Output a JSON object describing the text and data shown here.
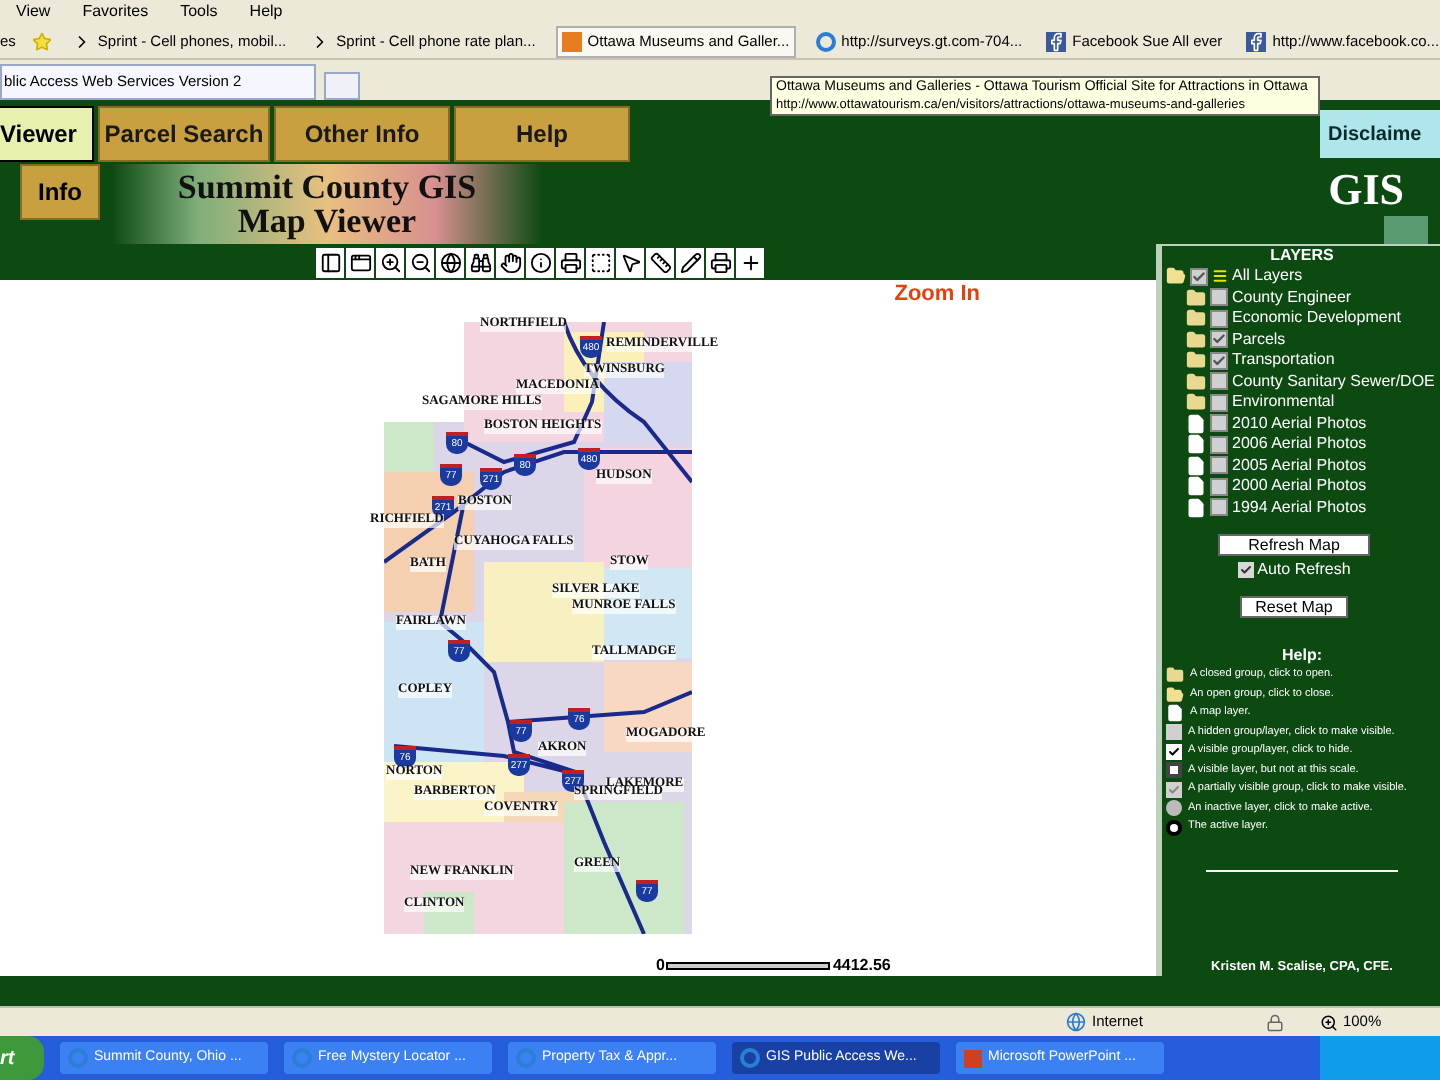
{
  "browser": {
    "menu": [
      "View",
      "Favorites",
      "Tools",
      "Help"
    ],
    "favorites": [
      {
        "label": "es",
        "kind": "text"
      },
      {
        "label": "Sprint - Cell phones, mobil...",
        "kind": "page"
      },
      {
        "label": "Sprint - Cell phone rate plan...",
        "kind": "page"
      },
      {
        "label": "Ottawa Museums and Galler...",
        "kind": "hover"
      },
      {
        "label": "http://surveys.gt.com-704...",
        "kind": "ie"
      },
      {
        "label": "Facebook Sue All ever",
        "kind": "facebook"
      },
      {
        "label": "http://www.facebook.co...",
        "kind": "facebook"
      }
    ],
    "tab": "blic Access Web Services Version 2",
    "tooltip": {
      "title": "Ottawa Museums and Galleries - Ottawa Tourism Official Site for Attractions in Ottawa",
      "url": "http://www.ottawatourism.ca/en/visitors/attractions/ottawa-museums-and-galleries"
    }
  },
  "nav": {
    "tabs": [
      {
        "label": "Viewer",
        "selected": true
      },
      {
        "label": "Parcel Search",
        "selected": false
      },
      {
        "label": "Other Info",
        "selected": false
      },
      {
        "label": "Help",
        "selected": false
      }
    ],
    "subtab": {
      "label": "Info",
      "selected": false
    },
    "disclaimer": "Disclaime"
  },
  "banner": {
    "title": "Summit County GIS",
    "subtitle": "Map Viewer"
  },
  "logo": "GIS",
  "map": {
    "mode": "Zoom In",
    "places": [
      "NORTHFIELD",
      "REMINDERVILLE",
      "TWINSBURG",
      "MACEDONIA",
      "SAGAMORE HILLS",
      "BOSTON HEIGHTS",
      "HUDSON",
      "BOSTON",
      "RICHFIELD",
      "CUYAHOGA FALLS",
      "BATH",
      "STOW",
      "SILVER LAKE",
      "MUNROE FALLS",
      "FAIRLAWN",
      "TALLMADGE",
      "COPLEY",
      "MOGADORE",
      "AKRON",
      "NORTON",
      "LAKEMORE",
      "BARBERTON",
      "SPRINGFIELD",
      "COVENTRY",
      "GREEN",
      "NEW FRANKLIN",
      "CLINTON"
    ],
    "shields": [
      "480",
      "80",
      "77",
      "271",
      "80",
      "480",
      "271",
      "77",
      "77",
      "76",
      "76",
      "277",
      "277",
      "77"
    ],
    "scale": {
      "start": "0",
      "end": "4412.56"
    }
  },
  "layers": {
    "title": "LAYERS",
    "items": [
      {
        "label": "All Layers",
        "kind": "group",
        "checked": true,
        "expanded": true,
        "children": [
          {
            "label": "County Engineer",
            "kind": "group",
            "checked": false,
            "expanded": false
          },
          {
            "label": "Economic Development",
            "kind": "group",
            "checked": false,
            "expanded": false
          },
          {
            "label": "Parcels",
            "kind": "group",
            "checked": true,
            "expanded": false
          },
          {
            "label": "Transportation",
            "kind": "group",
            "checked": true,
            "expanded": false
          },
          {
            "label": "County Sanitary Sewer/DOE",
            "kind": "group",
            "checked": false,
            "expanded": false
          },
          {
            "label": "Environmental",
            "kind": "group",
            "checked": false,
            "expanded": false
          },
          {
            "label": "2010 Aerial Photos",
            "kind": "layer",
            "checked": false
          },
          {
            "label": "2006 Aerial Photos",
            "kind": "layer",
            "checked": false
          },
          {
            "label": "2005 Aerial Photos",
            "kind": "layer",
            "checked": false
          },
          {
            "label": "2000 Aerial Photos",
            "kind": "layer",
            "checked": false
          },
          {
            "label": "1994 Aerial Photos",
            "kind": "layer",
            "checked": false
          }
        ]
      }
    ],
    "refresh": "Refresh Map",
    "auto_refresh": {
      "label": "Auto Refresh",
      "checked": true
    },
    "reset": "Reset Map"
  },
  "help": {
    "title": "Help:",
    "items": [
      {
        "kind": "closed",
        "text": "A closed group, click to open."
      },
      {
        "kind": "open",
        "text": "An open group, click to close."
      },
      {
        "kind": "layer",
        "text": "A map layer."
      },
      {
        "kind": "hidden",
        "text": "A hidden group/layer, click to make visible."
      },
      {
        "kind": "visible",
        "text": "A visible group/layer, click to hide."
      },
      {
        "kind": "scale",
        "text": "A visible layer, but not at this scale."
      },
      {
        "kind": "partial",
        "text": "A partially visible group, click to make visible."
      },
      {
        "kind": "inactive",
        "text": "An inactive layer, click to make active."
      },
      {
        "kind": "active",
        "text": "The active layer."
      }
    ]
  },
  "credit": "Kristen M. Scalise, CPA, CFE.",
  "status": {
    "zone": "Internet",
    "zoom": "100%"
  },
  "taskbar": {
    "start": "rt",
    "tasks": [
      {
        "label": "Summit County, Ohio ...",
        "kind": "ie",
        "selected": false
      },
      {
        "label": "Free Mystery Locator ...",
        "kind": "ie",
        "selected": false
      },
      {
        "label": "Property Tax & Appr...",
        "kind": "ie",
        "selected": false
      },
      {
        "label": "GIS Public Access We...",
        "kind": "ie",
        "selected": true
      },
      {
        "label": "Microsoft PowerPoint ...",
        "kind": "ppt",
        "selected": false
      }
    ]
  }
}
